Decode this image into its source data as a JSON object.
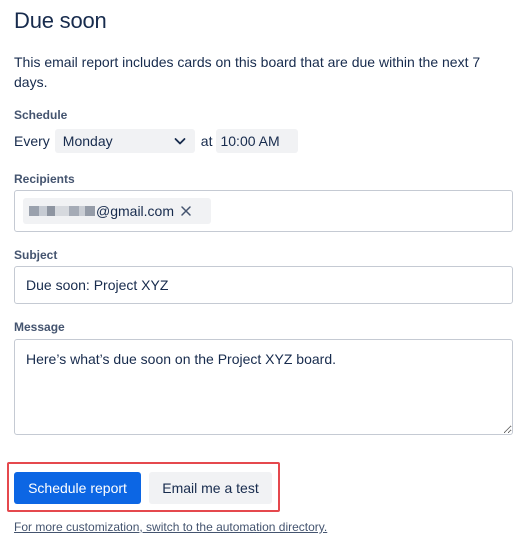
{
  "header": {
    "title": "Due soon",
    "description": "This email report includes cards on this board that are due within the next 7 days."
  },
  "schedule": {
    "label": "Schedule",
    "every_word": "Every",
    "day_value": "Monday",
    "at_word": "at",
    "time_value": "10:00 AM"
  },
  "recipients": {
    "label": "Recipients",
    "chip_email_visible": "@gmail.com",
    "remove_icon": "close-icon"
  },
  "subject": {
    "label": "Subject",
    "value": "Due soon: Project XYZ"
  },
  "message": {
    "label": "Message",
    "value": "Here’s what’s due soon on the Project XYZ board."
  },
  "actions": {
    "schedule_label": "Schedule report",
    "test_label": "Email me a test"
  },
  "footer": {
    "link_text": "For more customization, switch to the automation directory."
  },
  "colors": {
    "primary": "#0c66e4",
    "highlight": "#e5484d",
    "field_bg": "#f1f2f4",
    "text": "#172b4d"
  }
}
